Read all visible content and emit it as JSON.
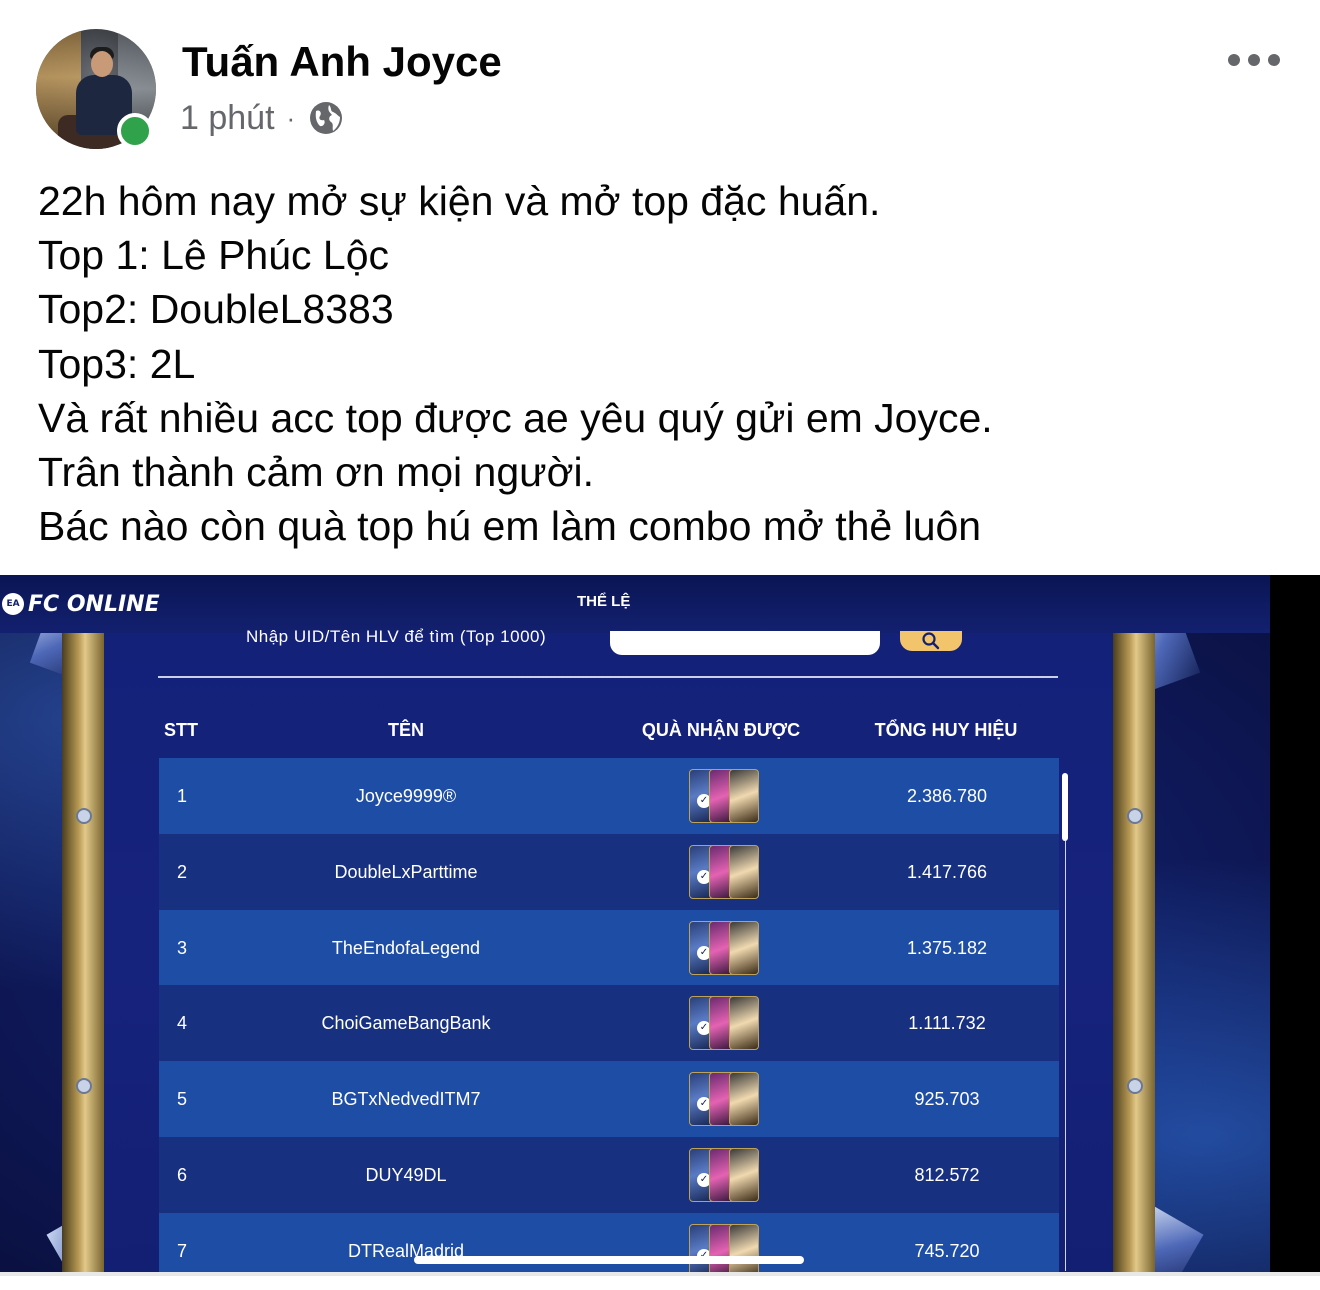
{
  "post": {
    "author": "Tuấn Anh Joyce",
    "time": "1 phút",
    "separator": "·",
    "privacy_icon": "globe-icon",
    "menu_icon": "more-horizontal-icon",
    "online": true,
    "lines": [
      "22h hôm nay mở sự kiện và mở top đặc huấn.",
      "Top 1: Lê Phúc Lộc",
      "Top2: DoubleL8383",
      "Top3: 2L",
      "Và rất nhiều acc top được ae yêu quý gửi em Joyce.",
      "Trân thành cảm ơn mọi người.",
      "Bác nào còn quà top hú em làm combo mở thẻ luôn"
    ]
  },
  "game": {
    "logo_badge": "EA",
    "logo_text": "FC ONLINE",
    "rules_label": "THỂ LỆ",
    "search_label": "Nhập UID/Tên HLV để tìm (Top 1000)",
    "search_value": "",
    "search_icon": "search-icon",
    "columns": [
      "STT",
      "TÊN",
      "QUÀ NHẬN ĐƯỢC",
      "TỔNG HUY HIỆU"
    ],
    "rows": [
      {
        "rank": "1",
        "name": "Joyce9999®",
        "points": "2.386.780"
      },
      {
        "rank": "2",
        "name": "DoubleLxParttime",
        "points": "1.417.766"
      },
      {
        "rank": "3",
        "name": "TheEndofaLegend",
        "points": "1.375.182"
      },
      {
        "rank": "4",
        "name": "ChoiGameBangBank",
        "points": "1.111.732"
      },
      {
        "rank": "5",
        "name": "BGTxNedvedITM7",
        "points": "925.703"
      },
      {
        "rank": "6",
        "name": "DUY49DL",
        "points": "812.572"
      },
      {
        "rank": "7",
        "name": "DTRealMadrid",
        "points": "745.720"
      }
    ],
    "colors": {
      "row_odd": "#1d4da4",
      "row_even": "#17307f",
      "search_button": "#f2c46c",
      "online": "#31a24c"
    }
  }
}
